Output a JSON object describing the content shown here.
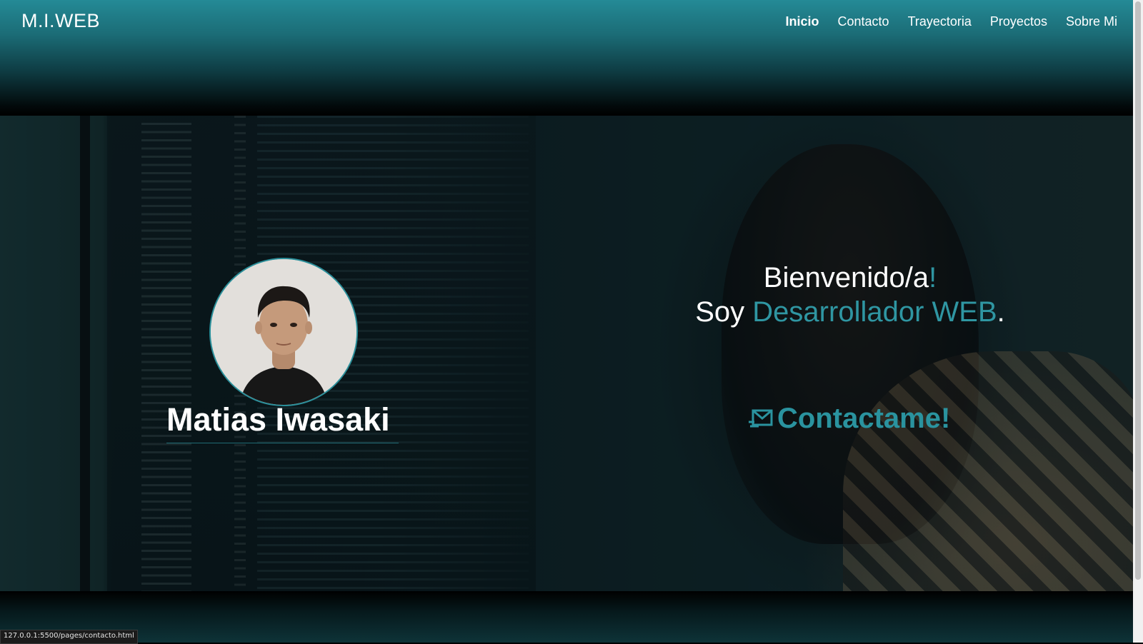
{
  "header": {
    "logo": "M.I.WEB",
    "nav": [
      {
        "label": "Inicio",
        "active": true
      },
      {
        "label": "Contacto"
      },
      {
        "label": "Trayectoria"
      },
      {
        "label": "Proyectos"
      },
      {
        "label": "Sobre Mi"
      }
    ]
  },
  "profile": {
    "name": "Matias Iwasaki",
    "avatar_icon": "profile-photo"
  },
  "hero": {
    "greeting": "Bienvenido/a",
    "greeting_mark": "!",
    "intro_prefix": "Soy ",
    "role": "Desarrollador WEB",
    "intro_suffix": ".",
    "cta_label": "Contactame!",
    "cta_icon": "mail-icon"
  },
  "status_bar": {
    "url": "127.0.0.1:5500/pages/contacto.html"
  },
  "colors": {
    "accent": "#2a939f",
    "header_top": "#248a96"
  }
}
